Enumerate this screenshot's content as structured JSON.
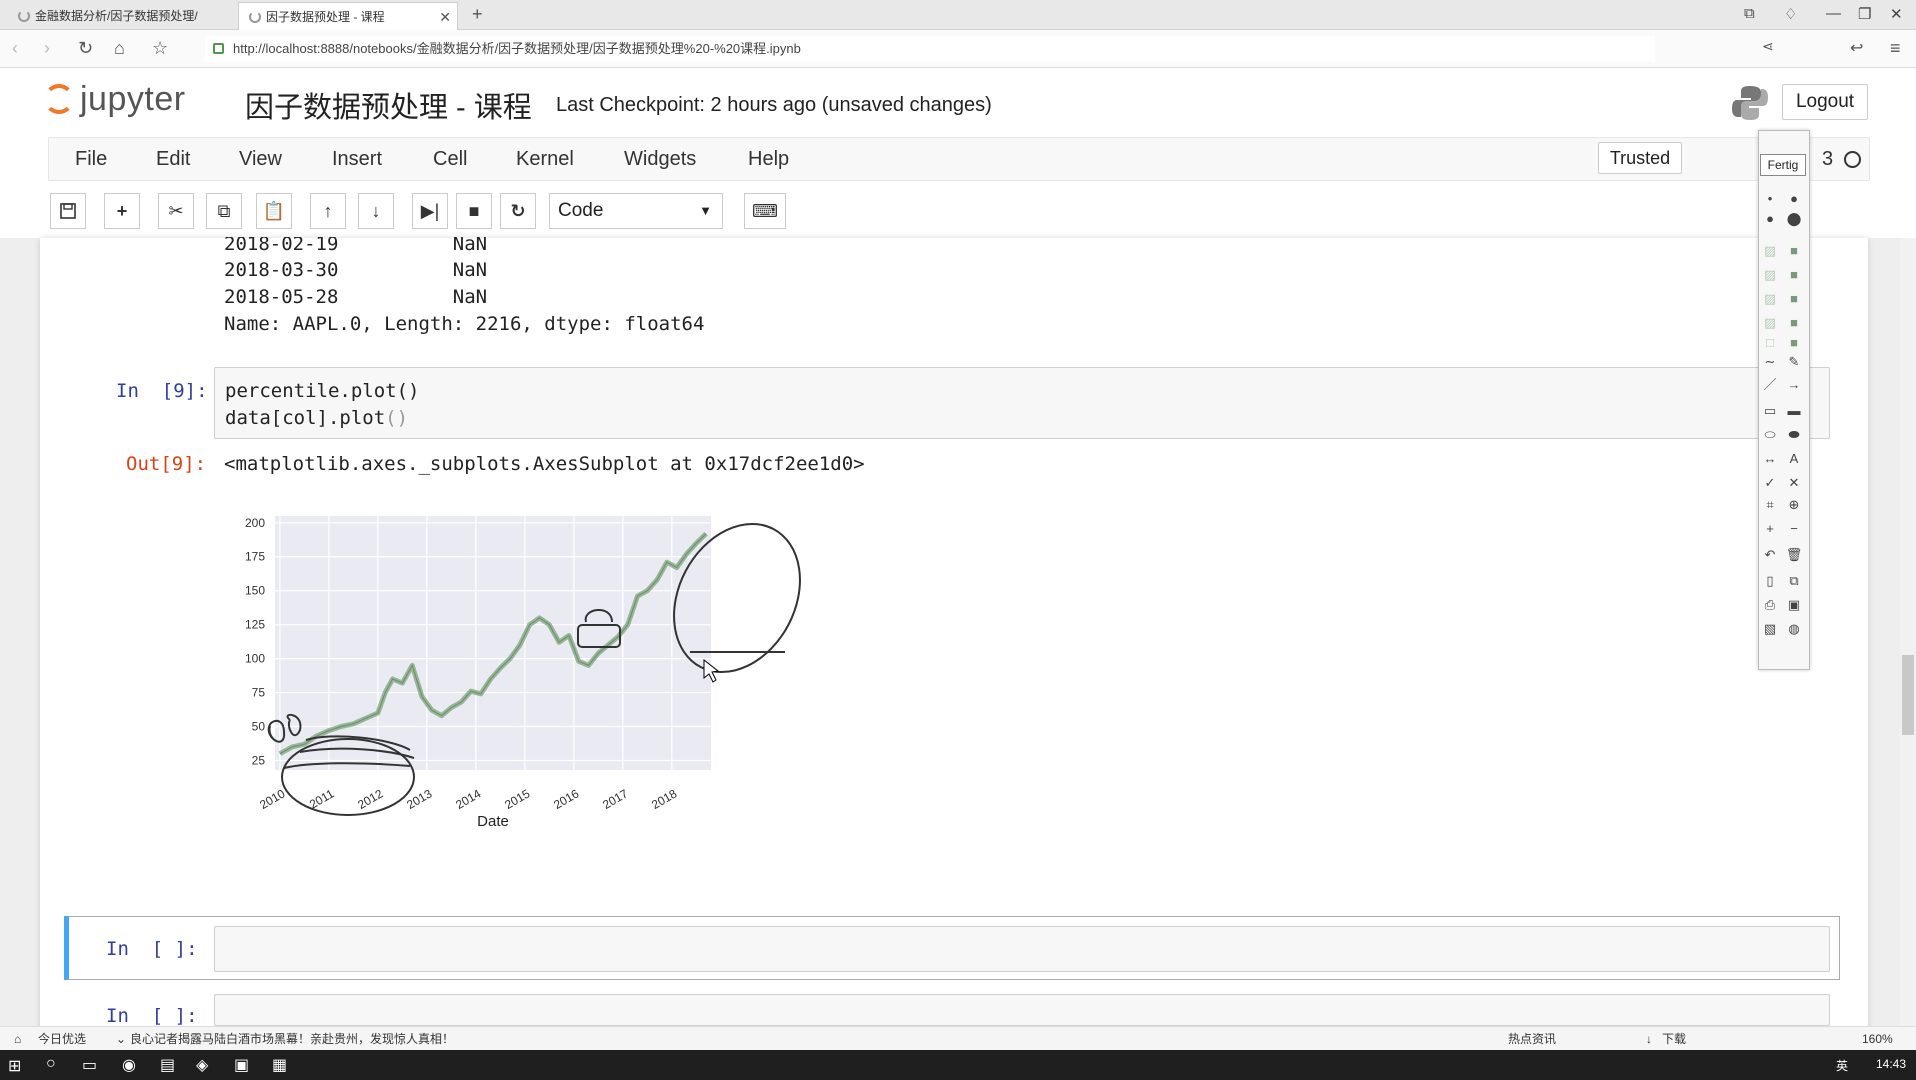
{
  "browser": {
    "tabs": [
      {
        "label": "金融数据分析/因子数据预处理/"
      },
      {
        "label": "因子数据预处理 - 课程"
      }
    ],
    "new_tab": "+",
    "url": "http://localhost:8888/notebooks/金融数据分析/因子数据预处理/因子数据预处理%20-%20课程.ipynb"
  },
  "header": {
    "logo": "jupyter",
    "title": "因子数据预处理 - 课程",
    "checkpoint": "Last Checkpoint: 2 hours ago (unsaved changes)",
    "logout": "Logout"
  },
  "menubar": {
    "items": [
      "File",
      "Edit",
      "View",
      "Insert",
      "Cell",
      "Kernel",
      "Widgets",
      "Help"
    ],
    "trusted": "Trusted",
    "kernel": "3"
  },
  "toolbar": {
    "cell_type": "Code"
  },
  "output_prev": {
    "lines": [
      "2018-02-19          NaN",
      "2018-03-30          NaN",
      "2018-05-28          NaN"
    ],
    "footer": "Name: AAPL.0, Length: 2216, dtype: float64"
  },
  "cell9": {
    "in_prompt": "In  [9]:",
    "code_line1": "percentile.plot()",
    "code_line2_a": "data[col].plot",
    "code_line2_b": "()",
    "out_prompt": "Out[9]:",
    "out_text": "<matplotlib.axes._subplots.AxesSubplot at 0x17dcf2ee1d0>"
  },
  "empty_cells": [
    {
      "prompt": "In  [ ]:"
    },
    {
      "prompt": "In  [ ]:"
    }
  ],
  "palette": {
    "done": "Fertig",
    "text_tool": "A"
  },
  "statusbar": {
    "left": "今日优选",
    "news": "良心记者揭露马陆白酒市场黑幕！亲赴贵州，发现惊人真相！",
    "right_info": "热点资讯",
    "download": "下载",
    "zoom": "160%"
  },
  "taskbar": {
    "time": "14:43",
    "ime": "英"
  },
  "chart_data": {
    "type": "line",
    "xlabel": "Date",
    "ylabel": "",
    "x_ticks": [
      "2010",
      "2011",
      "2012",
      "2013",
      "2014",
      "2015",
      "2016",
      "2017",
      "2018"
    ],
    "y_ticks": [
      25,
      50,
      75,
      100,
      125,
      150,
      175,
      200
    ],
    "ylim": [
      18,
      205
    ],
    "xlim": [
      2009.9,
      2018.8
    ],
    "grid": true,
    "series": [
      {
        "color": "#8fb08f",
        "x": [
          2010.0,
          2010.25,
          2010.5,
          2010.75,
          2011.0,
          2011.25,
          2011.5,
          2011.75,
          2012.0,
          2012.15,
          2012.3,
          2012.5,
          2012.7,
          2012.9,
          2013.1,
          2013.3,
          2013.5,
          2013.7,
          2013.9,
          2014.1,
          2014.3,
          2014.5,
          2014.7,
          2014.9,
          2015.1,
          2015.3,
          2015.5,
          2015.7,
          2015.9,
          2016.1,
          2016.3,
          2016.5,
          2016.7,
          2016.9,
          2017.1,
          2017.3,
          2017.5,
          2017.7,
          2017.9,
          2018.1,
          2018.3,
          2018.5,
          2018.7
        ],
        "y": [
          30,
          35,
          37,
          43,
          47,
          50,
          52,
          56,
          60,
          75,
          85,
          82,
          95,
          72,
          62,
          58,
          64,
          68,
          76,
          74,
          85,
          93,
          100,
          110,
          125,
          130,
          125,
          112,
          117,
          98,
          95,
          104,
          110,
          116,
          125,
          146,
          150,
          158,
          171,
          167,
          177,
          185,
          192
        ]
      }
    ]
  }
}
